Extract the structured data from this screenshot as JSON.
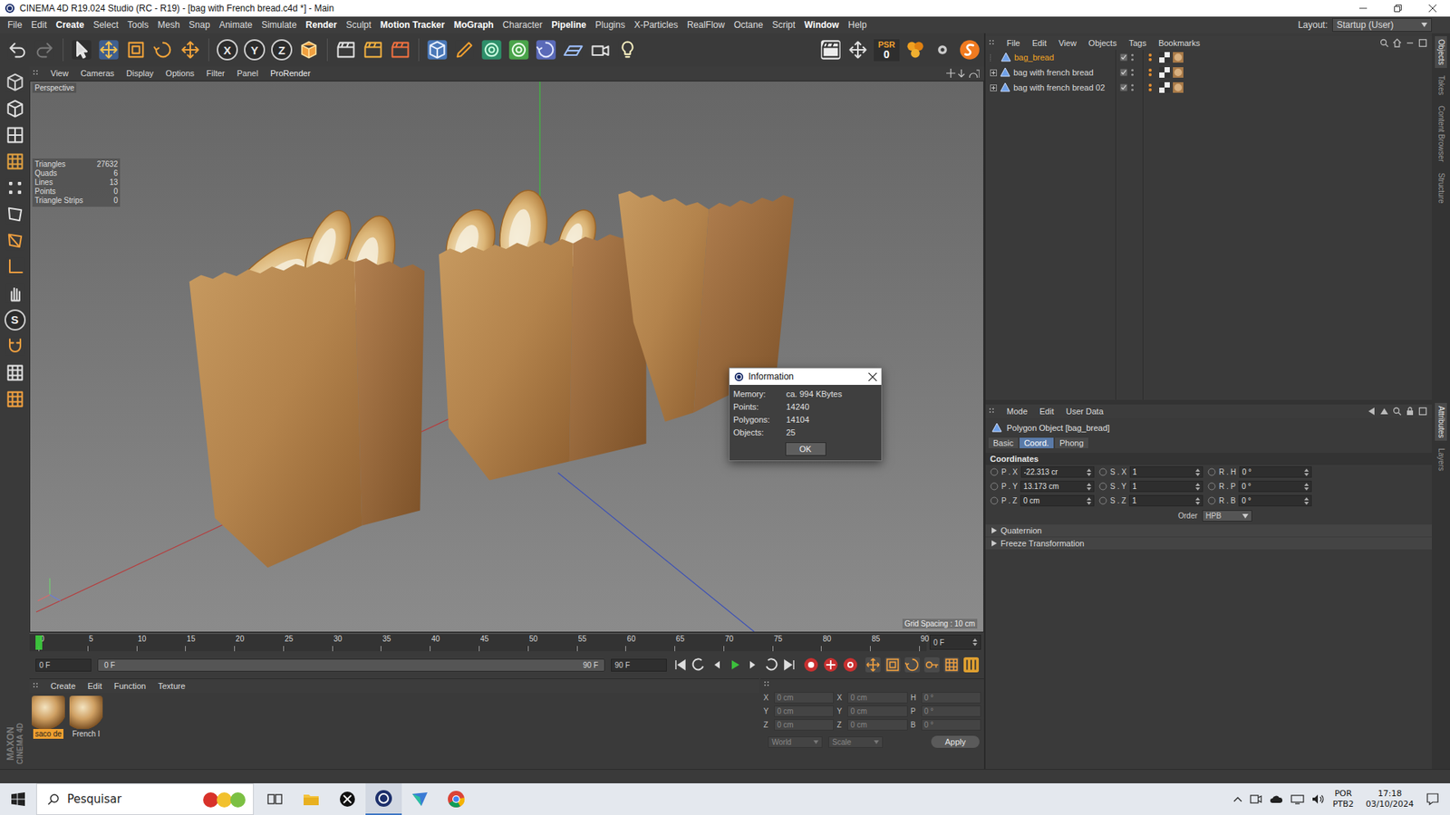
{
  "window": {
    "title": "CINEMA 4D R19.024 Studio (RC - R19) - [bag with French bread.c4d *] - Main"
  },
  "menu": [
    {
      "label": "File",
      "bold": false
    },
    {
      "label": "Edit",
      "bold": false
    },
    {
      "label": "Create",
      "bold": true
    },
    {
      "label": "Select",
      "bold": false
    },
    {
      "label": "Tools",
      "bold": false
    },
    {
      "label": "Mesh",
      "bold": false
    },
    {
      "label": "Snap",
      "bold": false
    },
    {
      "label": "Animate",
      "bold": false
    },
    {
      "label": "Simulate",
      "bold": false
    },
    {
      "label": "Render",
      "bold": true
    },
    {
      "label": "Sculpt",
      "bold": false
    },
    {
      "label": "Motion Tracker",
      "bold": true
    },
    {
      "label": "MoGraph",
      "bold": true
    },
    {
      "label": "Character",
      "bold": false
    },
    {
      "label": "Pipeline",
      "bold": true
    },
    {
      "label": "Plugins",
      "bold": false
    },
    {
      "label": "X-Particles",
      "bold": false
    },
    {
      "label": "RealFlow",
      "bold": false
    },
    {
      "label": "Octane",
      "bold": false
    },
    {
      "label": "Script",
      "bold": false
    },
    {
      "label": "Window",
      "bold": true
    },
    {
      "label": "Help",
      "bold": false
    }
  ],
  "layout": {
    "label": "Layout:",
    "value": "Startup (User)"
  },
  "toolbar": {
    "axes": [
      "X",
      "Y",
      "Z"
    ],
    "psr_label": "PSR",
    "psr_value": "0"
  },
  "left_tools": {
    "snap_label": "S"
  },
  "viewport": {
    "menu": [
      "View",
      "Cameras",
      "Display",
      "Options",
      "Filter",
      "Panel",
      "ProRender"
    ],
    "camera": "Perspective",
    "stats": [
      {
        "label": "Triangles",
        "value": "27632"
      },
      {
        "label": "Quads",
        "value": "6"
      },
      {
        "label": "Lines",
        "value": "13"
      },
      {
        "label": "Points",
        "value": "0"
      },
      {
        "label": "Triangle Strips",
        "value": "0"
      }
    ],
    "grid": "Grid Spacing : 10 cm"
  },
  "dialog": {
    "title": "Information",
    "rows": [
      {
        "label": "Memory:",
        "value": "ca. 994 KBytes"
      },
      {
        "label": "Points:",
        "value": "14240"
      },
      {
        "label": "Polygons:",
        "value": "14104"
      },
      {
        "label": "Objects:",
        "value": "25"
      }
    ],
    "button": "OK"
  },
  "object_manager": {
    "menu": [
      "File",
      "Edit",
      "View",
      "Objects",
      "Tags",
      "Bookmarks"
    ],
    "objects": [
      {
        "name": "bag_bread",
        "selected": true,
        "expandable": false
      },
      {
        "name": "bag with french bread",
        "selected": false,
        "expandable": true
      },
      {
        "name": "bag with french bread 02",
        "selected": false,
        "expandable": true
      }
    ]
  },
  "attributes": {
    "menu": [
      "Mode",
      "Edit",
      "User Data"
    ],
    "title": "Polygon Object [bag_bread]",
    "tabs": [
      {
        "label": "Basic",
        "selected": false
      },
      {
        "label": "Coord.",
        "selected": true
      },
      {
        "label": "Phong",
        "selected": false
      }
    ],
    "section": "Coordinates",
    "rows": [
      [
        {
          "label": "P . X",
          "value": "-22.313 cr"
        },
        {
          "label": "S . X",
          "value": "1"
        },
        {
          "label": "R . H",
          "value": "0 °"
        }
      ],
      [
        {
          "label": "P . Y",
          "value": "13.173 cm"
        },
        {
          "label": "S . Y",
          "value": "1"
        },
        {
          "label": "R . P",
          "value": "0 °"
        }
      ],
      [
        {
          "label": "P . Z",
          "value": "0 cm"
        },
        {
          "label": "S . Z",
          "value": "1"
        },
        {
          "label": "R . B",
          "value": "0 °"
        }
      ]
    ],
    "order": {
      "label": "Order",
      "value": "HPB"
    },
    "groups": [
      "Quaternion",
      "Freeze Transformation"
    ]
  },
  "side_tabs": {
    "top": [
      {
        "label": "Objects",
        "selected": true
      },
      {
        "label": "Takes",
        "selected": false
      },
      {
        "label": "Content Browser",
        "selected": false
      },
      {
        "label": "Structure",
        "selected": false
      }
    ],
    "bottom": [
      {
        "label": "Attributes",
        "selected": true
      },
      {
        "label": "Layers",
        "selected": false
      }
    ]
  },
  "timeline": {
    "ticks": [
      "0",
      "5",
      "10",
      "15",
      "20",
      "25",
      "30",
      "35",
      "40",
      "45",
      "50",
      "55",
      "60",
      "65",
      "70",
      "75",
      "80",
      "85",
      "90"
    ],
    "level": 0,
    "frame": "0 F"
  },
  "playback": {
    "start": "0 F",
    "range_start": "0 F",
    "range_end": "90 F",
    "end": "90 F"
  },
  "materials": {
    "menu": [
      "Create",
      "Edit",
      "Function",
      "Texture"
    ],
    "items": [
      {
        "name": "saco de",
        "selected": true
      },
      {
        "name": "French I",
        "selected": false
      }
    ]
  },
  "coords": {
    "rows": [
      {
        "a": "X",
        "av": "0 cm",
        "b": "X",
        "bv": "0 cm",
        "c": "H",
        "cv": "0 °"
      },
      {
        "a": "Y",
        "av": "0 cm",
        "b": "Y",
        "bv": "0 cm",
        "c": "P",
        "cv": "0 °"
      },
      {
        "a": "Z",
        "av": "0 cm",
        "b": "Z",
        "bv": "0 cm",
        "c": "B",
        "cv": "0 °"
      }
    ],
    "mode": "World",
    "type": "Scale",
    "apply": "Apply"
  },
  "brand": [
    "MAXON",
    "CINEMA 4D"
  ],
  "taskbar": {
    "search": "Pesquisar",
    "lang": [
      "POR",
      "PTB2"
    ],
    "time": "17:18",
    "date": "03/10/2024"
  }
}
